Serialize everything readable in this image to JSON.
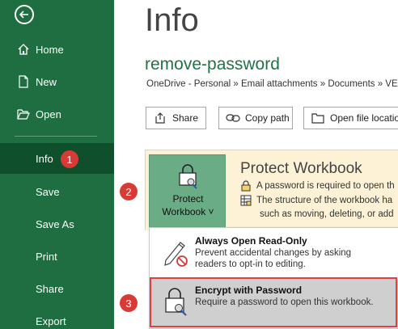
{
  "sidebar": {
    "items": [
      {
        "label": "Home",
        "icon": "home-icon"
      },
      {
        "label": "New",
        "icon": "new-document-icon"
      },
      {
        "label": "Open",
        "icon": "folder-open-icon"
      },
      {
        "label": "Info"
      },
      {
        "label": "Save"
      },
      {
        "label": "Save As"
      },
      {
        "label": "Print"
      },
      {
        "label": "Share"
      },
      {
        "label": "Export"
      }
    ],
    "active": "Info"
  },
  "steps": {
    "one": "1",
    "two": "2",
    "three": "3"
  },
  "main": {
    "title": "Info",
    "file_name": "remove-password",
    "breadcrumb": "OneDrive - Personal » Email attachments » Documents » VE",
    "buttons": {
      "share": "Share",
      "copy_path": "Copy path",
      "open_location": "Open file location"
    }
  },
  "protect": {
    "button_line1": "Protect",
    "button_line2": "Workbook ˅",
    "title": "Protect Workbook",
    "line1": "A password is required to open th",
    "line2": "The structure of the workbook ha",
    "line3": "such as moving, deleting, or add"
  },
  "menu": {
    "items": [
      {
        "title": "Always Open Read-Only",
        "desc1": "Prevent accidental changes by asking",
        "desc2": "readers to opt-in to editing."
      },
      {
        "title": "Encrypt with Password",
        "desc1": "Require a password to open this workbook."
      }
    ]
  },
  "colors": {
    "sidebar": "#1e6e42",
    "sidebar_active": "#0f4f2c",
    "accent_green": "#217346",
    "step_badge": "#d83b35",
    "highlight_frame": "#e04040"
  }
}
